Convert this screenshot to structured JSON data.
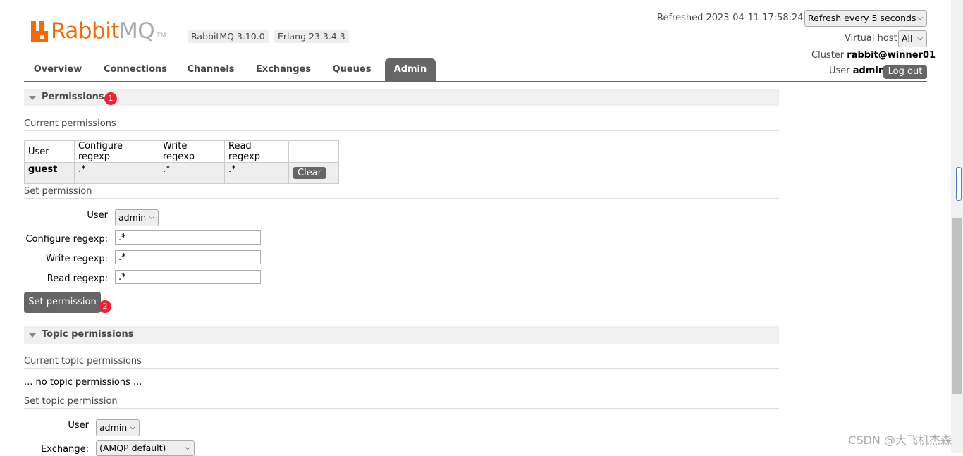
{
  "header": {
    "logo_brand_1": "Rabbit",
    "logo_brand_2": "MQ",
    "logo_tm": "TM",
    "version_badge": "RabbitMQ 3.10.0",
    "erlang_badge": "Erlang 23.3.4.3",
    "refreshed_label": "Refreshed 2023-04-11 17:58:24",
    "refresh_select": "Refresh every 5 seconds",
    "vhost_label": "Virtual host",
    "vhost_select": "All",
    "cluster_label": "Cluster",
    "cluster_value": "rabbit@winner01",
    "user_label": "User",
    "user_value": "admin",
    "logout_label": "Log out"
  },
  "tabs": [
    "Overview",
    "Connections",
    "Channels",
    "Exchanges",
    "Queues",
    "Admin"
  ],
  "permissions": {
    "title": "Permissions",
    "badge": "1",
    "current_title": "Current permissions",
    "columns": [
      "User",
      "Configure regexp",
      "Write regexp",
      "Read regexp",
      ""
    ],
    "rows": [
      {
        "user": "guest",
        "configure": ".*",
        "write": ".*",
        "read": ".*",
        "action": "Clear"
      }
    ],
    "set_title": "Set permission",
    "user_label": "User",
    "user_value": "admin",
    "configure_label": "Configure regexp:",
    "configure_value": ".*",
    "write_label": "Write regexp:",
    "write_value": ".*",
    "read_label": "Read regexp:",
    "read_value": ".*",
    "submit_label": "Set permission",
    "submit_badge": "2"
  },
  "topic_permissions": {
    "title": "Topic permissions",
    "current_title": "Current topic permissions",
    "empty_text": "... no topic permissions ...",
    "set_title": "Set topic permission",
    "user_label": "User",
    "user_value": "admin",
    "exchange_label": "Exchange:",
    "exchange_value": "(AMQP default)"
  },
  "watermark": "CSDN @大飞机杰森",
  "colors": {
    "brand": "#ff6600",
    "tab_active": "#666666",
    "badge": "#e22233"
  }
}
